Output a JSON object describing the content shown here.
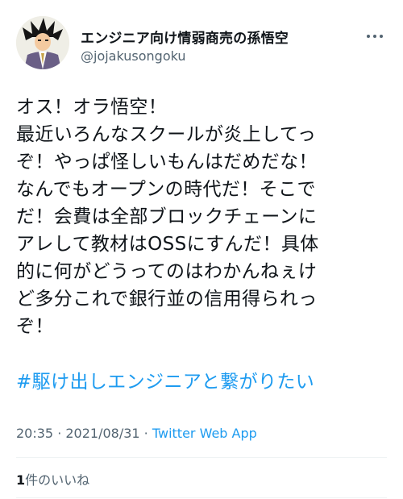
{
  "author": {
    "display_name": "エンジニア向け情弱商売の孫悟空",
    "handle": "@jojakusongoku",
    "avatar_icon": "goku-suit-avatar"
  },
  "tweet": {
    "lines": [
      "オス！オラ悟空！",
      "最近いろんなスクールが炎上してっ",
      "ぞ！やっぱ怪しいもんはだめだな！",
      "なんでもオープンの時代だ！そこで",
      "だ！会費は全部ブロックチェーンに",
      "アレして教材はOSSにすんだ！具体",
      "的に何がどうってのはわかんねぇけ",
      "ど多分これで銀行並の信用得られっ",
      "ぞ！"
    ],
    "hashtag": "#駆け出しエンジニアと繋がりたい"
  },
  "meta": {
    "time": "20:35",
    "separator1": " · ",
    "date": "2021/08/31",
    "separator2": " · ",
    "source": "Twitter Web App"
  },
  "likes": {
    "count": "1",
    "label": "件のいいね"
  },
  "colors": {
    "link": "#1d9bf0",
    "secondary_text": "#536471",
    "divider": "#eff3f4"
  }
}
